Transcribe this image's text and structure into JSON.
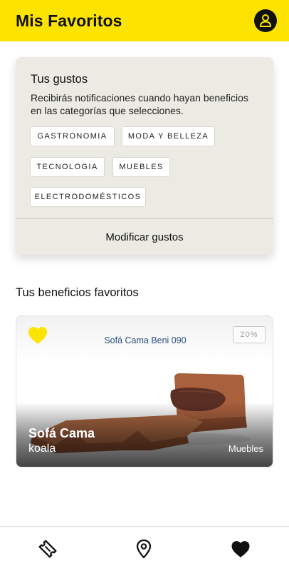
{
  "header": {
    "title": "Mis Favoritos",
    "profile_icon": "user-icon"
  },
  "preferences": {
    "title": "Tus gustos",
    "description": "Recibirás notificaciones cuando hayan beneficios en las categorías que selecciones.",
    "categories": [
      "GASTRONOMIA",
      "MODA Y BELLEZA",
      "TECNOLOGIA",
      "MUEBLES",
      "ELECTRODOMÉSTICOS"
    ],
    "modify_label": "Modificar gustos"
  },
  "favorites": {
    "section_title": "Tus beneficios favoritos",
    "items": [
      {
        "image_caption": "Sofá Cama Beni 090",
        "discount": "20%",
        "title": "Sofá Cama",
        "brand": "koala",
        "category": "Muebles",
        "favorite_icon": "heart-icon"
      }
    ]
  },
  "bottom_nav": {
    "items": [
      {
        "icon": "ticket-icon",
        "active": false
      },
      {
        "icon": "location-pin-icon",
        "active": false
      },
      {
        "icon": "heart-icon",
        "active": true
      }
    ]
  },
  "colors": {
    "brand_yellow": "#fce300",
    "card_background": "#ebeae3",
    "text_dark": "#111111"
  }
}
